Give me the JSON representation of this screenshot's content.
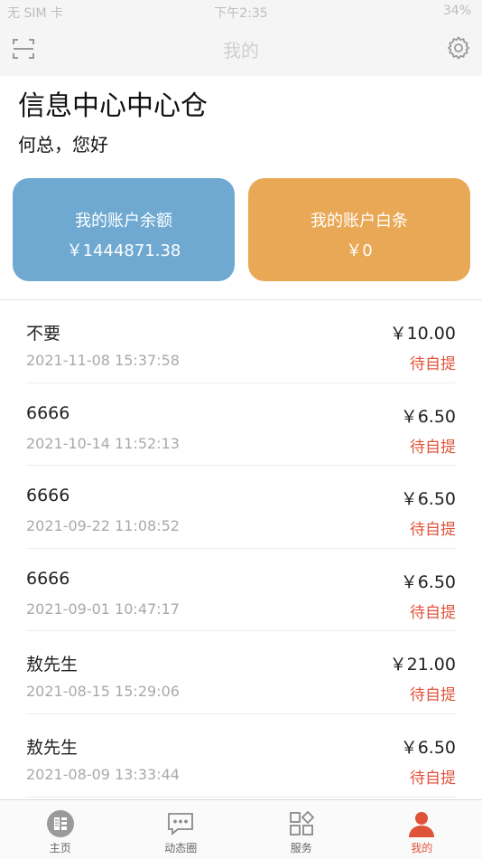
{
  "status_bar": {
    "carrier": "无 SIM 卡",
    "time": "下午2:35",
    "battery": "34%"
  },
  "nav": {
    "title": "我的"
  },
  "header": {
    "shop_name": "信息中心中心仓",
    "greeting": "何总，您好"
  },
  "cards": [
    {
      "label": "我的账户余额",
      "value": "￥1444871.38",
      "color": "#6fa9d1"
    },
    {
      "label": "我的账户白条",
      "value": "￥0",
      "color": "#e9a855"
    }
  ],
  "orders": [
    {
      "name": "不要",
      "date": "2021-11-08 15:37:58",
      "amount": "￥10.00",
      "status": "待自提"
    },
    {
      "name": "6666",
      "date": "2021-10-14 11:52:13",
      "amount": "￥6.50",
      "status": "待自提"
    },
    {
      "name": "6666",
      "date": "2021-09-22 11:08:52",
      "amount": "￥6.50",
      "status": "待自提"
    },
    {
      "name": "6666",
      "date": "2021-09-01 10:47:17",
      "amount": "￥6.50",
      "status": "待自提"
    },
    {
      "name": "敖先生",
      "date": "2021-08-15 15:29:06",
      "amount": "￥21.00",
      "status": "待自提"
    },
    {
      "name": "敖先生",
      "date": "2021-08-09 13:33:44",
      "amount": "￥6.50",
      "status": "待自提"
    }
  ],
  "tabs": [
    {
      "label": "主页",
      "icon": "home-icon"
    },
    {
      "label": "动态圈",
      "icon": "chat-bubble-icon"
    },
    {
      "label": "服务",
      "icon": "grid-icon"
    },
    {
      "label": "我的",
      "icon": "person-icon",
      "active": true
    }
  ],
  "colors": {
    "accent": "#e0533b",
    "balance_card": "#6fa9d1",
    "credit_card": "#e9a855"
  }
}
